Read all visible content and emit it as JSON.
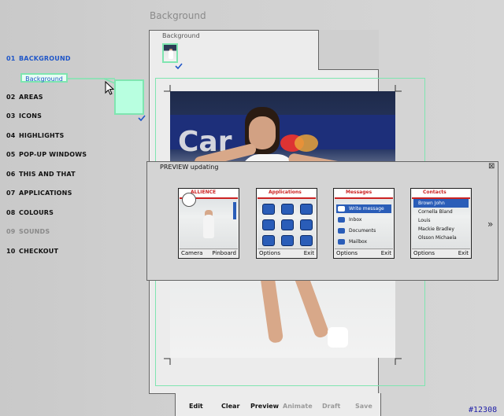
{
  "page_title": "Background",
  "sidebar": {
    "items": [
      {
        "num": "01",
        "label": "BACKGROUND",
        "state": "active"
      },
      {
        "num": "02",
        "label": "AREAS",
        "state": "normal"
      },
      {
        "num": "03",
        "label": "ICONS",
        "state": "normal"
      },
      {
        "num": "04",
        "label": "HIGHLIGHTS",
        "state": "normal"
      },
      {
        "num": "05",
        "label": "POP-UP WINDOWS",
        "state": "normal"
      },
      {
        "num": "06",
        "label": "THIS AND THAT",
        "state": "normal"
      },
      {
        "num": "07",
        "label": "APPLICATIONS",
        "state": "normal"
      },
      {
        "num": "08",
        "label": "COLOURS",
        "state": "normal"
      },
      {
        "num": "09",
        "label": "SOUNDS",
        "state": "dimmed"
      },
      {
        "num": "10",
        "label": "CHECKOUT",
        "state": "normal"
      }
    ]
  },
  "drag_label": "Background",
  "panel": {
    "header_label": "Background"
  },
  "preview": {
    "title": "PREVIEW updating",
    "close_glyph": "⊠",
    "next_glyph": "»",
    "phones": [
      {
        "header": "ALLIENCE",
        "left": "Camera",
        "right": "Pinboard",
        "kind": "idle"
      },
      {
        "header": "Applications",
        "left": "Options",
        "right": "Exit",
        "kind": "grid"
      },
      {
        "header": "Messages",
        "left": "Options",
        "right": "Exit",
        "kind": "menu",
        "rows": [
          "Write message",
          "Inbox",
          "Documents",
          "Mailbox"
        ]
      },
      {
        "header": "Contacts",
        "left": "Options",
        "right": "Exit",
        "kind": "list",
        "rows": [
          "Brown John",
          "Cornella Bland",
          "Louis",
          "Mackie Bradley",
          "Olsson Michaela"
        ]
      }
    ]
  },
  "toolbar": {
    "buttons": [
      {
        "label": "Edit",
        "enabled": true
      },
      {
        "label": "Clear",
        "enabled": true
      },
      {
        "label": "Preview",
        "enabled": true
      },
      {
        "label": "Animate",
        "enabled": false
      },
      {
        "label": "Draft",
        "enabled": false
      },
      {
        "label": "Save",
        "enabled": false
      }
    ]
  },
  "footer_code": "#12308",
  "colors": {
    "accent_blue": "#1f56c8",
    "highlight_green": "#7fe5b0",
    "drop_fill": "#b8ffe0",
    "overlay_bg": "#d4d4d4",
    "check_blue": "#1f56c8"
  }
}
